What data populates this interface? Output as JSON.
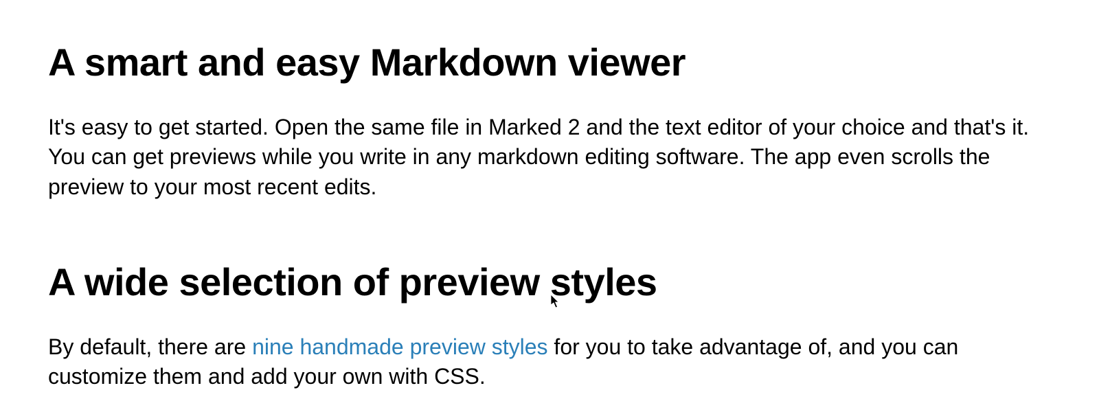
{
  "sections": [
    {
      "heading": "A smart and easy Markdown viewer",
      "paragraph": "It's easy to get started. Open the same file in Marked 2 and the text editor of your choice and that's it. You can get previews while you write in any markdown editing software. The app even scrolls the preview to your most recent edits."
    },
    {
      "heading": "A wide selection of preview styles",
      "paragraph_before_link": "By default, there are ",
      "link_text": "nine handmade preview styles",
      "paragraph_after_link": " for you to take advantage of, and you can customize them and add your own with CSS."
    }
  ]
}
